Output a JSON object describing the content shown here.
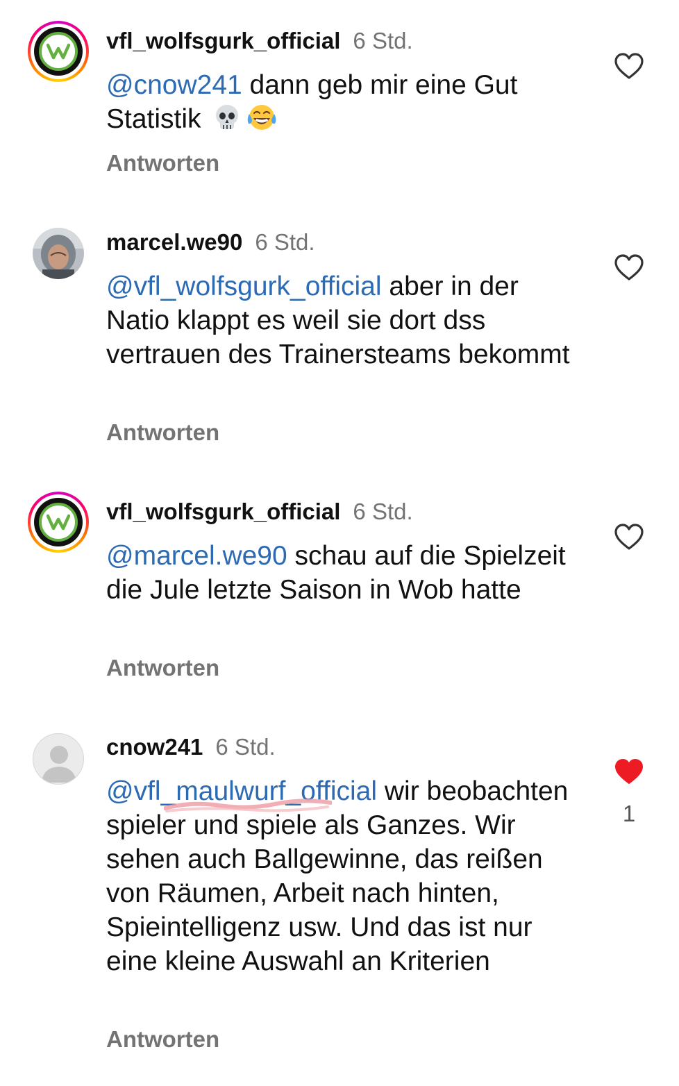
{
  "comments": [
    {
      "username": "vfl_wolfsgurk_official",
      "time": "6 Std.",
      "mention": "@cnow241",
      "text": " dann geb mir eine Gut Statistik",
      "emojis": [
        "skull-emoji",
        "tears-of-joy-emoji"
      ],
      "reply_label": "Antworten",
      "liked": false,
      "avatar": "wolfsgurk-logo"
    },
    {
      "username": "marcel.we90",
      "time": "6 Std.",
      "mention": "@vfl_wolfsgurk_official",
      "text": " aber in der Natio klappt es weil sie dort dss vertrauen des Trainersteams bekommt",
      "reply_label": "Antworten",
      "liked": false,
      "avatar": "user-photo"
    },
    {
      "username": "vfl_wolfsgurk_official",
      "time": "6 Std.",
      "mention": "@marcel.we90",
      "text": " schau auf die Spielzeit die Jule letzte Saison in Wob hatte",
      "reply_label": "Antworten",
      "liked": false,
      "avatar": "wolfsgurk-logo"
    },
    {
      "username": "cnow241",
      "time": "6 Std.",
      "mention": "@vfl_maulwurf_official",
      "text": " wir beobachten spieler und spiele als Ganzes. Wir sehen auch Ballgewinne, das reißen von Räumen, Arbeit nach hinten, Spieintelligenz usw. Und das ist nur eine kleine Auswahl an Kriterien",
      "reply_label": "Antworten",
      "liked": true,
      "like_count": "1",
      "avatar": "default-avatar"
    }
  ],
  "colors": {
    "mention": "#2c6bb4",
    "muted": "#737373",
    "heart_liked": "#ed1c24",
    "logo_green": "#63b040"
  },
  "icons": [
    "heart-outline-icon",
    "heart-filled-icon",
    "default-user-icon"
  ]
}
